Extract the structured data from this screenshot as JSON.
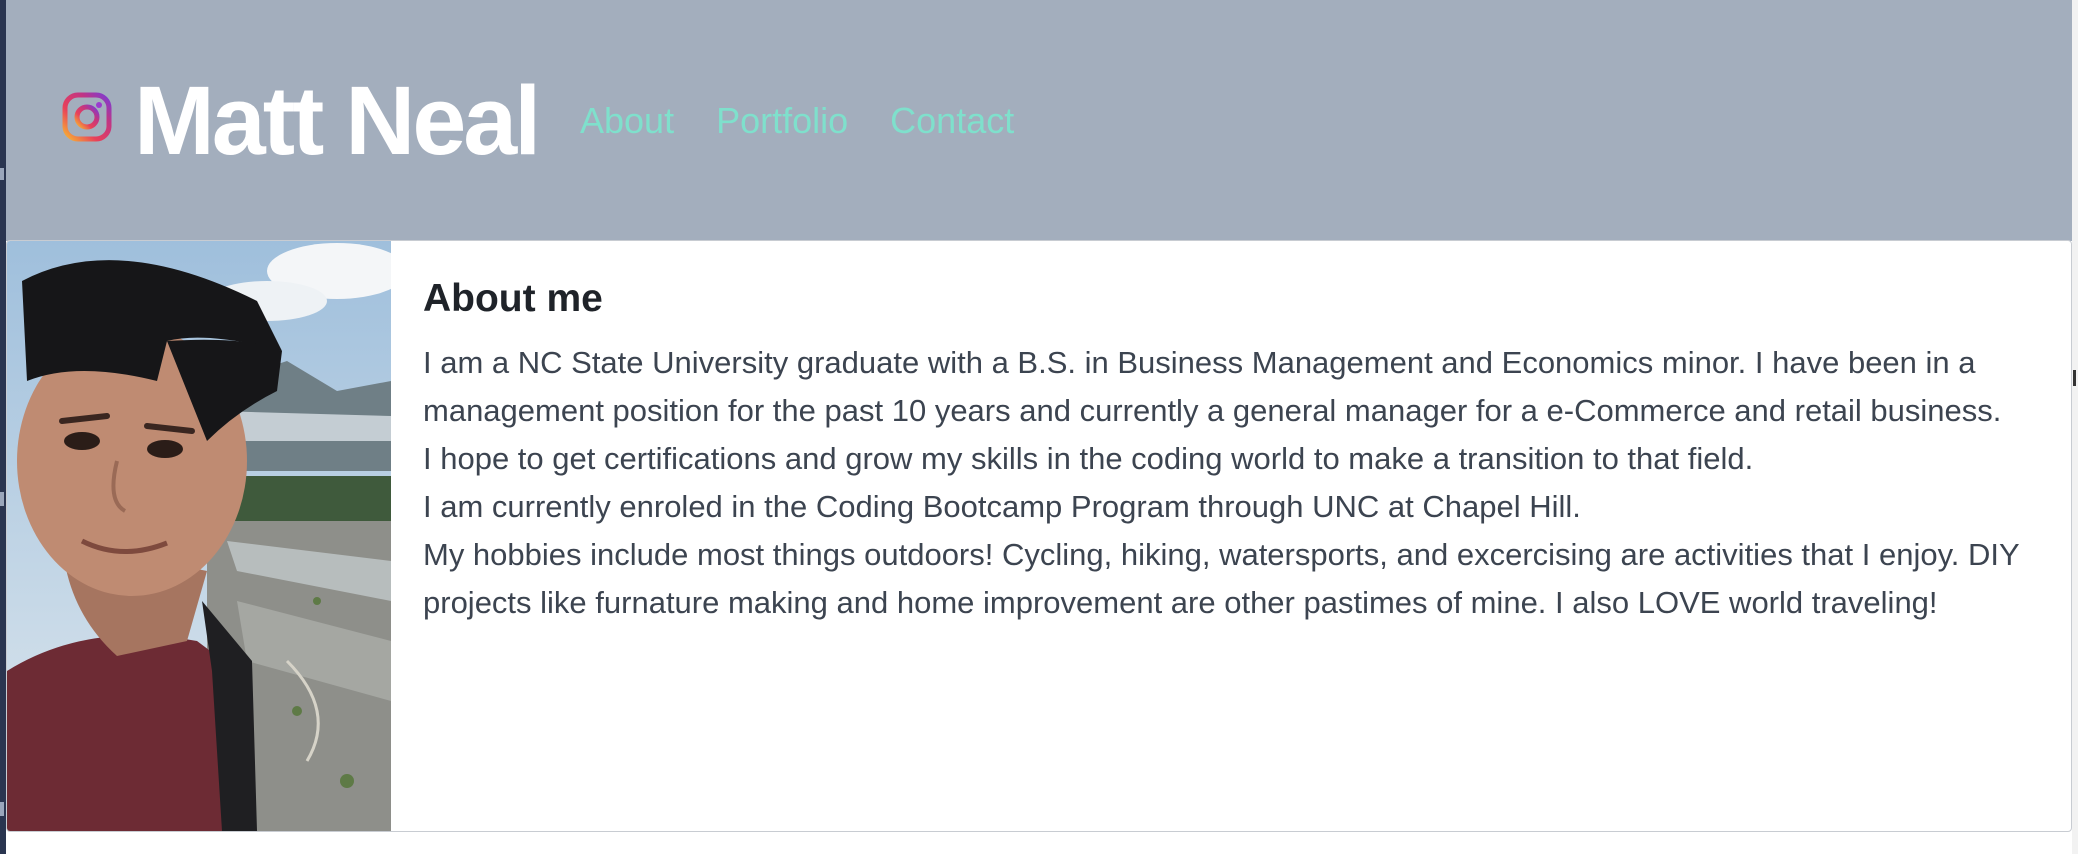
{
  "header": {
    "brand_icon": "instagram-icon",
    "title": "Matt Neal",
    "nav": [
      "About",
      "Portfolio",
      "Contact"
    ]
  },
  "about": {
    "photo_icon": "profile-photo",
    "heading": "About me",
    "paragraphs": [
      "I am a NC State University graduate with a B.S. in Business Management and Economics minor. I have been in a management position for the past 10 years and currently a general manager for a e-Commerce and retail business.",
      "I hope to get certifications and grow my skills in the coding world to make a transition to that field.",
      "I am currently enroled in the Coding Bootcamp Program through UNC at Chapel Hill.",
      "My hobbies include most things outdoors! Cycling, hiking, watersports, and excercising are activities that I enjoy. DIY projects like furnature making and home improvement are other pastimes of mine. I also LOVE world traveling!"
    ]
  },
  "colors": {
    "header_bg": "#a3aebd",
    "nav_link": "#7fe0cc",
    "title": "#ffffff",
    "body_text": "#3c4450"
  }
}
